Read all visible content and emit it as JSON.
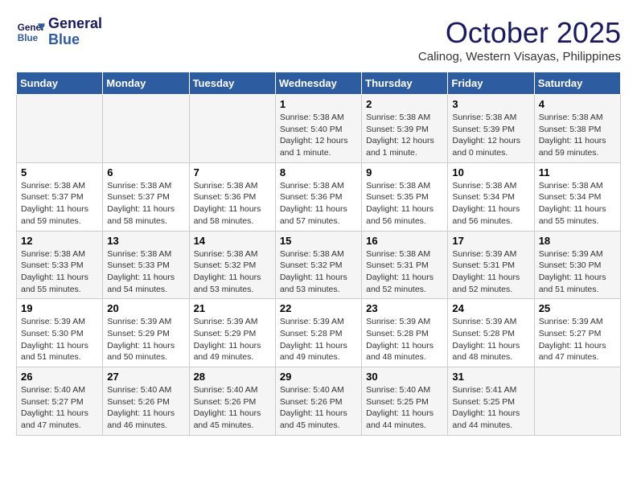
{
  "header": {
    "logo_line1": "General",
    "logo_line2": "Blue",
    "month": "October 2025",
    "location": "Calinog, Western Visayas, Philippines"
  },
  "weekdays": [
    "Sunday",
    "Monday",
    "Tuesday",
    "Wednesday",
    "Thursday",
    "Friday",
    "Saturday"
  ],
  "weeks": [
    [
      {
        "day": "",
        "info": ""
      },
      {
        "day": "",
        "info": ""
      },
      {
        "day": "",
        "info": ""
      },
      {
        "day": "1",
        "info": "Sunrise: 5:38 AM\nSunset: 5:40 PM\nDaylight: 12 hours\nand 1 minute."
      },
      {
        "day": "2",
        "info": "Sunrise: 5:38 AM\nSunset: 5:39 PM\nDaylight: 12 hours\nand 1 minute."
      },
      {
        "day": "3",
        "info": "Sunrise: 5:38 AM\nSunset: 5:39 PM\nDaylight: 12 hours\nand 0 minutes."
      },
      {
        "day": "4",
        "info": "Sunrise: 5:38 AM\nSunset: 5:38 PM\nDaylight: 11 hours\nand 59 minutes."
      }
    ],
    [
      {
        "day": "5",
        "info": "Sunrise: 5:38 AM\nSunset: 5:37 PM\nDaylight: 11 hours\nand 59 minutes."
      },
      {
        "day": "6",
        "info": "Sunrise: 5:38 AM\nSunset: 5:37 PM\nDaylight: 11 hours\nand 58 minutes."
      },
      {
        "day": "7",
        "info": "Sunrise: 5:38 AM\nSunset: 5:36 PM\nDaylight: 11 hours\nand 58 minutes."
      },
      {
        "day": "8",
        "info": "Sunrise: 5:38 AM\nSunset: 5:36 PM\nDaylight: 11 hours\nand 57 minutes."
      },
      {
        "day": "9",
        "info": "Sunrise: 5:38 AM\nSunset: 5:35 PM\nDaylight: 11 hours\nand 56 minutes."
      },
      {
        "day": "10",
        "info": "Sunrise: 5:38 AM\nSunset: 5:34 PM\nDaylight: 11 hours\nand 56 minutes."
      },
      {
        "day": "11",
        "info": "Sunrise: 5:38 AM\nSunset: 5:34 PM\nDaylight: 11 hours\nand 55 minutes."
      }
    ],
    [
      {
        "day": "12",
        "info": "Sunrise: 5:38 AM\nSunset: 5:33 PM\nDaylight: 11 hours\nand 55 minutes."
      },
      {
        "day": "13",
        "info": "Sunrise: 5:38 AM\nSunset: 5:33 PM\nDaylight: 11 hours\nand 54 minutes."
      },
      {
        "day": "14",
        "info": "Sunrise: 5:38 AM\nSunset: 5:32 PM\nDaylight: 11 hours\nand 53 minutes."
      },
      {
        "day": "15",
        "info": "Sunrise: 5:38 AM\nSunset: 5:32 PM\nDaylight: 11 hours\nand 53 minutes."
      },
      {
        "day": "16",
        "info": "Sunrise: 5:38 AM\nSunset: 5:31 PM\nDaylight: 11 hours\nand 52 minutes."
      },
      {
        "day": "17",
        "info": "Sunrise: 5:39 AM\nSunset: 5:31 PM\nDaylight: 11 hours\nand 52 minutes."
      },
      {
        "day": "18",
        "info": "Sunrise: 5:39 AM\nSunset: 5:30 PM\nDaylight: 11 hours\nand 51 minutes."
      }
    ],
    [
      {
        "day": "19",
        "info": "Sunrise: 5:39 AM\nSunset: 5:30 PM\nDaylight: 11 hours\nand 51 minutes."
      },
      {
        "day": "20",
        "info": "Sunrise: 5:39 AM\nSunset: 5:29 PM\nDaylight: 11 hours\nand 50 minutes."
      },
      {
        "day": "21",
        "info": "Sunrise: 5:39 AM\nSunset: 5:29 PM\nDaylight: 11 hours\nand 49 minutes."
      },
      {
        "day": "22",
        "info": "Sunrise: 5:39 AM\nSunset: 5:28 PM\nDaylight: 11 hours\nand 49 minutes."
      },
      {
        "day": "23",
        "info": "Sunrise: 5:39 AM\nSunset: 5:28 PM\nDaylight: 11 hours\nand 48 minutes."
      },
      {
        "day": "24",
        "info": "Sunrise: 5:39 AM\nSunset: 5:28 PM\nDaylight: 11 hours\nand 48 minutes."
      },
      {
        "day": "25",
        "info": "Sunrise: 5:39 AM\nSunset: 5:27 PM\nDaylight: 11 hours\nand 47 minutes."
      }
    ],
    [
      {
        "day": "26",
        "info": "Sunrise: 5:40 AM\nSunset: 5:27 PM\nDaylight: 11 hours\nand 47 minutes."
      },
      {
        "day": "27",
        "info": "Sunrise: 5:40 AM\nSunset: 5:26 PM\nDaylight: 11 hours\nand 46 minutes."
      },
      {
        "day": "28",
        "info": "Sunrise: 5:40 AM\nSunset: 5:26 PM\nDaylight: 11 hours\nand 45 minutes."
      },
      {
        "day": "29",
        "info": "Sunrise: 5:40 AM\nSunset: 5:26 PM\nDaylight: 11 hours\nand 45 minutes."
      },
      {
        "day": "30",
        "info": "Sunrise: 5:40 AM\nSunset: 5:25 PM\nDaylight: 11 hours\nand 44 minutes."
      },
      {
        "day": "31",
        "info": "Sunrise: 5:41 AM\nSunset: 5:25 PM\nDaylight: 11 hours\nand 44 minutes."
      },
      {
        "day": "",
        "info": ""
      }
    ]
  ]
}
